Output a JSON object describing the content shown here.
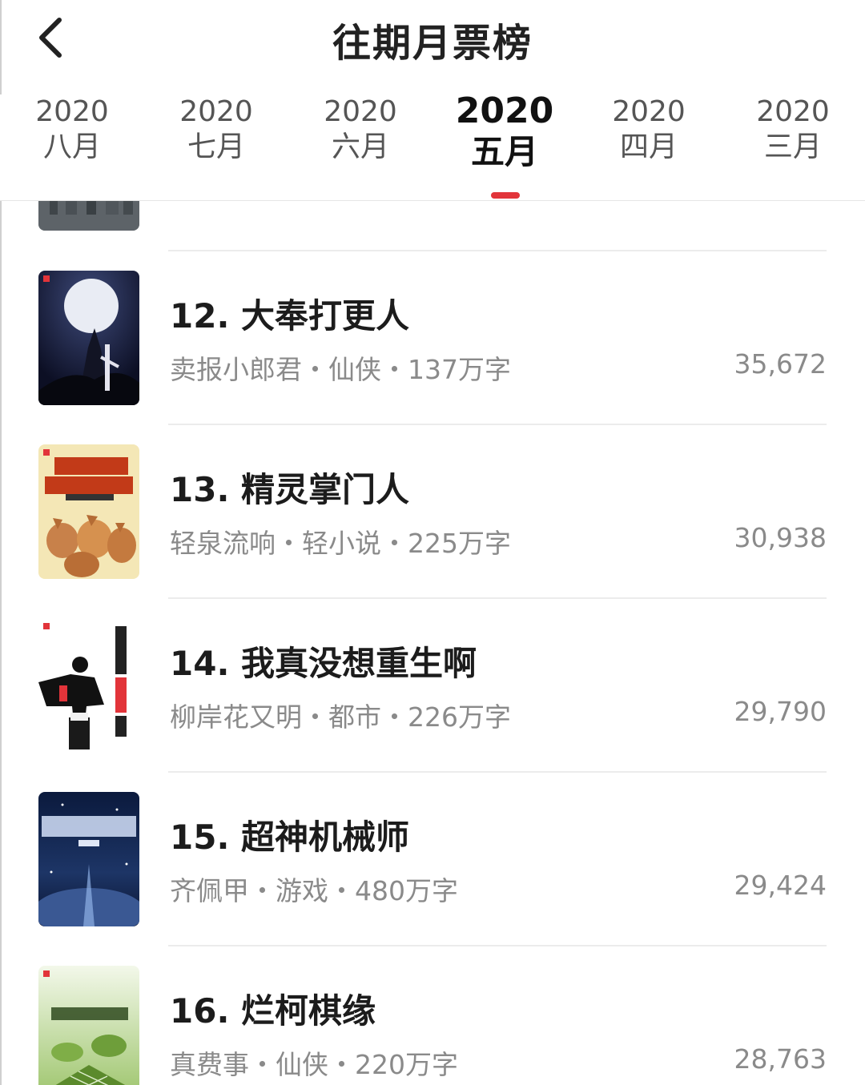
{
  "header": {
    "title": "往期月票榜"
  },
  "tabs": [
    {
      "year": "2020",
      "month": "八月",
      "active": false
    },
    {
      "year": "2020",
      "month": "七月",
      "active": false
    },
    {
      "year": "2020",
      "month": "六月",
      "active": false
    },
    {
      "year": "2020",
      "month": "五月",
      "active": true
    },
    {
      "year": "2020",
      "month": "四月",
      "active": false
    },
    {
      "year": "2020",
      "month": "三月",
      "active": false
    }
  ],
  "books": [
    {
      "rank_title": "12. 大奉打更人",
      "meta": "卖报小郎君・仙侠・137万字",
      "votes": "35,672"
    },
    {
      "rank_title": "13. 精灵掌门人",
      "meta": "轻泉流响・轻小说・225万字",
      "votes": "30,938"
    },
    {
      "rank_title": "14. 我真没想重生啊",
      "meta": "柳岸花又明・都市・226万字",
      "votes": "29,790"
    },
    {
      "rank_title": "15. 超神机械师",
      "meta": "齐佩甲・游戏・480万字",
      "votes": "29,424"
    },
    {
      "rank_title": "16. 烂柯棋缘",
      "meta": "真费事・仙侠・220万字",
      "votes": "28,763"
    }
  ],
  "colors": {
    "accent": "#e2343a",
    "meta_text": "#8a8a8a",
    "title_text": "#1c1c1c"
  },
  "icons": {
    "back": "chevron-left-icon"
  }
}
